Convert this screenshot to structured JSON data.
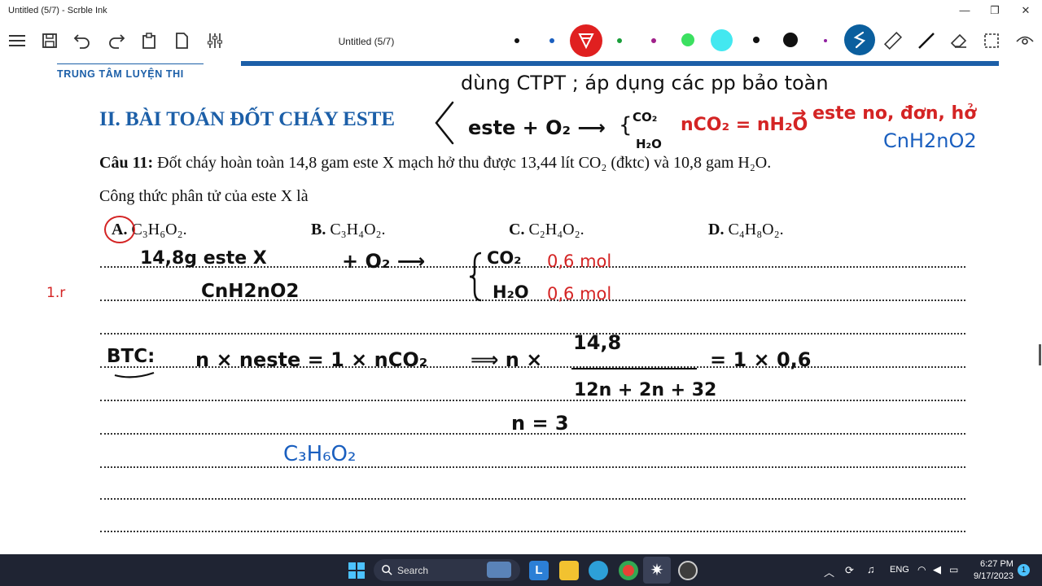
{
  "window": {
    "title": "Untitled (5/7) - Scrble Ink",
    "minimize_glyph": "—",
    "maximize_glyph": "❐",
    "close_glyph": "✕"
  },
  "toolbar": {
    "doc_title": "Untitled (5/7)",
    "icons": [
      "menu-icon",
      "save-icon",
      "undo-icon",
      "redo-icon",
      "paste-icon",
      "new-page-icon",
      "settings-sliders-icon"
    ],
    "pen_colors": [
      "#111111",
      "#1a5fbf",
      "#d42424",
      "#1a9e3a",
      "#a0208a",
      "#3be060",
      "#43e8f0",
      "#111111",
      "#111111",
      "#9020a0"
    ],
    "active_pen_color": "#e02020",
    "active_tool_color": "#0b5f9e",
    "right_icons": [
      "ruler-icon",
      "line-icon",
      "eraser-icon",
      "select-icon",
      "view-icon"
    ]
  },
  "page": {
    "header_brand": "TRUNG TÂM LUYỆN THI",
    "accent": "#1c5fa8",
    "section_title": "II. BÀI TOÁN ĐỐT CHÁY ESTE",
    "question_label": "Câu 11:",
    "question_text": "Đốt cháy hoàn toàn 14,8 gam este X mạch hở thu được 13,44 lít CO₂ (đktc) và 10,8 gam H₂O.",
    "question_line2": "Công thức phân tử của este X là",
    "options": [
      {
        "label": "A.",
        "formula": "C₃H₆O₂."
      },
      {
        "label": "B.",
        "formula": "C₃H₄O₂."
      },
      {
        "label": "C.",
        "formula": "C₂H₄O₂."
      },
      {
        "label": "D.",
        "formula": "C₄H₈O₂."
      }
    ]
  },
  "annotations": {
    "note1": "dùng CTPT ; áp dụng các pp bảo toàn",
    "note2_left": "este + O₂ ⟶",
    "note2_co2": "CO₂",
    "note2_h2o": "H₂O",
    "note2_rel": "nCO₂ = nH₂O",
    "note2_res": "→ este no, đơn, hở",
    "general_formula": "CnH2nO2",
    "line1_a": "14,8g este X",
    "line1_b": "CnH2nO2",
    "line1_c": "+ O₂ ⟶",
    "co2": "CO₂",
    "co2_mol": "0,6 mol",
    "h2o": "H₂O",
    "h2o_mol": "0,6 mol",
    "side_mark": "1.r",
    "btc": "BTC:",
    "btc_eq": "n × neste = 1 × nCO₂",
    "implies": "⟹ n ×",
    "frac_num": "14,8",
    "frac_den": "12n + 2n + 32",
    "frac_rhs": "= 1 × 0,6",
    "n_result": "n = 3",
    "answer": "C₃H₆O₂"
  },
  "taskbar": {
    "search_placeholder": "Search",
    "language": "ENG",
    "time": "6:27 PM",
    "date": "9/17/2023",
    "notification_count": "1"
  }
}
